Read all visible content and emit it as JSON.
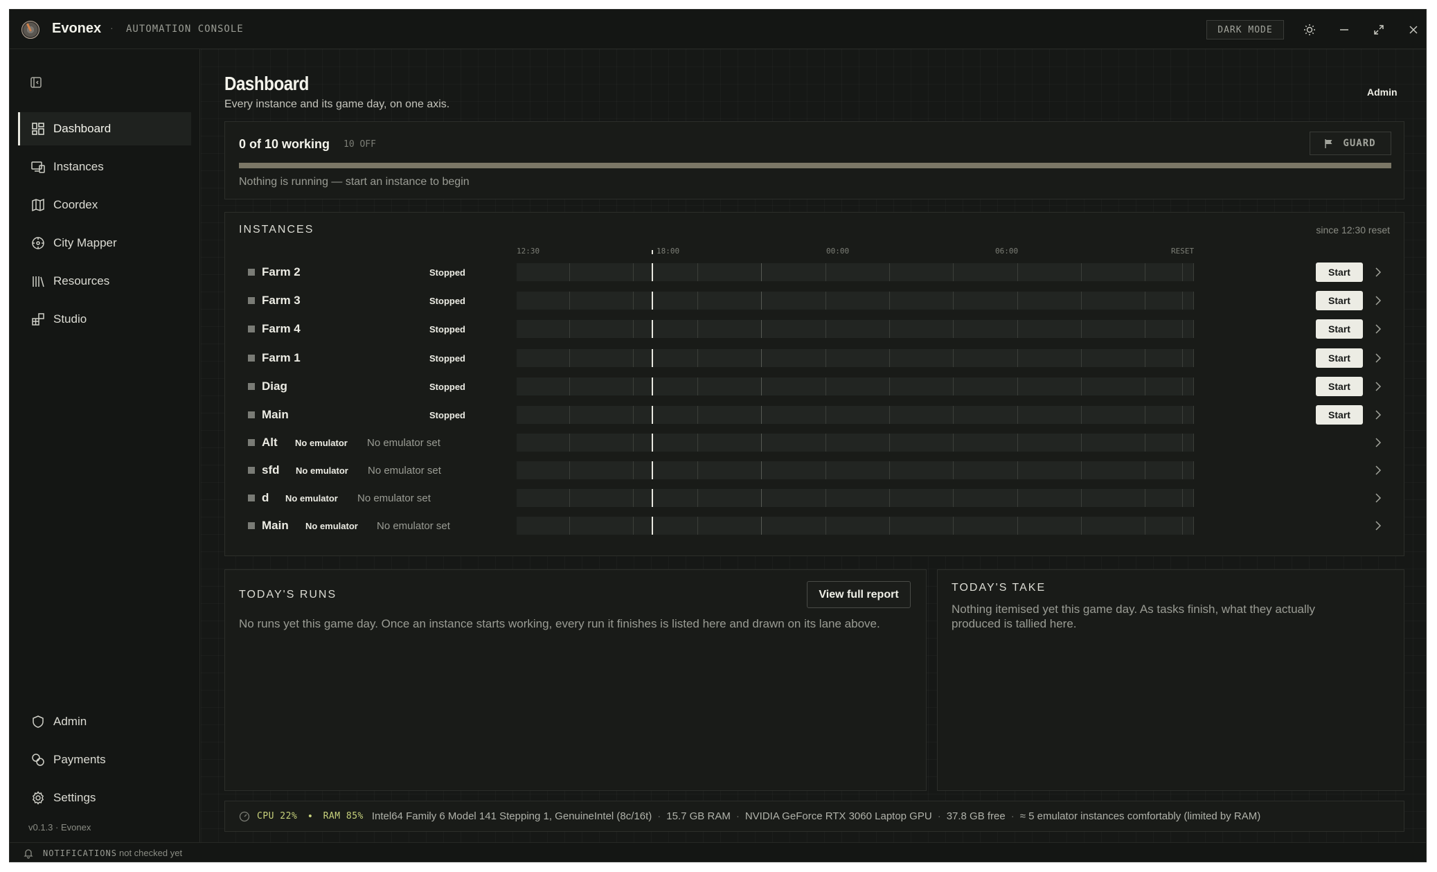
{
  "app": {
    "name": "Evonex",
    "separator": "·",
    "subtitle": "AUTOMATION CONSOLE",
    "dark_mode_label": "DARK MODE"
  },
  "sidebar": {
    "items": [
      {
        "label": "Dashboard",
        "icon": "dashboard-icon",
        "active": true
      },
      {
        "label": "Instances",
        "icon": "instances-icon"
      },
      {
        "label": "Coordex",
        "icon": "map-icon"
      },
      {
        "label": "City Mapper",
        "icon": "compass-icon"
      },
      {
        "label": "Resources",
        "icon": "library-icon"
      },
      {
        "label": "Studio",
        "icon": "studio-icon"
      }
    ],
    "bottom_items": [
      {
        "label": "Admin",
        "icon": "shield-icon"
      },
      {
        "label": "Payments",
        "icon": "coins-icon"
      },
      {
        "label": "Settings",
        "icon": "gear-icon"
      }
    ],
    "version": "v0.1.3 · Evonex"
  },
  "statusbar": {
    "notifications_label": "NOTIFICATIONS",
    "notifications_value": "not checked yet"
  },
  "page": {
    "title": "Dashboard",
    "subtitle": "Every instance and its game day, on one axis.",
    "user_role": "Admin"
  },
  "working": {
    "summary": "0 of 10 working",
    "off_count": "10 OFF",
    "guard_label": "GUARD",
    "message": "Nothing is running — start an instance to begin",
    "progress": 0
  },
  "instances": {
    "title": "INSTANCES",
    "since": "since 12:30 reset",
    "axis_ticks": [
      "12:30",
      "18:00",
      "00:00",
      "06:00",
      "RESET"
    ],
    "start_label": "Start",
    "rows": [
      {
        "name": "Farm 2",
        "status": "Stopped",
        "note": "",
        "startable": true
      },
      {
        "name": "Farm 3",
        "status": "Stopped",
        "note": "",
        "startable": true
      },
      {
        "name": "Farm 4",
        "status": "Stopped",
        "note": "",
        "startable": true
      },
      {
        "name": "Farm 1",
        "status": "Stopped",
        "note": "",
        "startable": true
      },
      {
        "name": "Diag",
        "status": "Stopped",
        "note": "",
        "startable": true
      },
      {
        "name": "Main",
        "status": "Stopped",
        "note": "",
        "startable": true
      },
      {
        "name": "Alt",
        "status": "No emulator",
        "note": "No emulator set",
        "startable": false
      },
      {
        "name": "sfd",
        "status": "No emulator",
        "note": "No emulator set",
        "startable": false
      },
      {
        "name": "d",
        "status": "No emulator",
        "note": "No emulator set",
        "startable": false
      },
      {
        "name": "Main",
        "status": "No emulator",
        "note": "No emulator set",
        "startable": false
      }
    ]
  },
  "runs": {
    "title": "TODAY'S RUNS",
    "button": "View full report",
    "message": "No runs yet this game day. Once an instance starts working, every run it finishes is listed here and drawn on its lane above."
  },
  "take": {
    "title": "TODAY'S TAKE",
    "message": "Nothing itemised yet this game day. As tasks finish, what they actually produced is tallied here."
  },
  "system": {
    "cpu": "CPU 22%",
    "dot": "•",
    "ram": "RAM 85%",
    "cpu_model": "Intel64 Family 6 Model 141 Stepping 1, GenuineIntel (8c/16t)",
    "ram_total": "15.7 GB RAM",
    "gpu": "NVIDIA GeForce RTX 3060 Laptop GPU",
    "disk_free": "37.8 GB free",
    "capacity": "≈ 5 emulator instances comfortably (limited by RAM)",
    "sep": "·"
  },
  "colors": {
    "background": "#141614",
    "accent": "#ecece4",
    "meter_text": "#c8d27c",
    "progress_track": "#7b7766"
  }
}
